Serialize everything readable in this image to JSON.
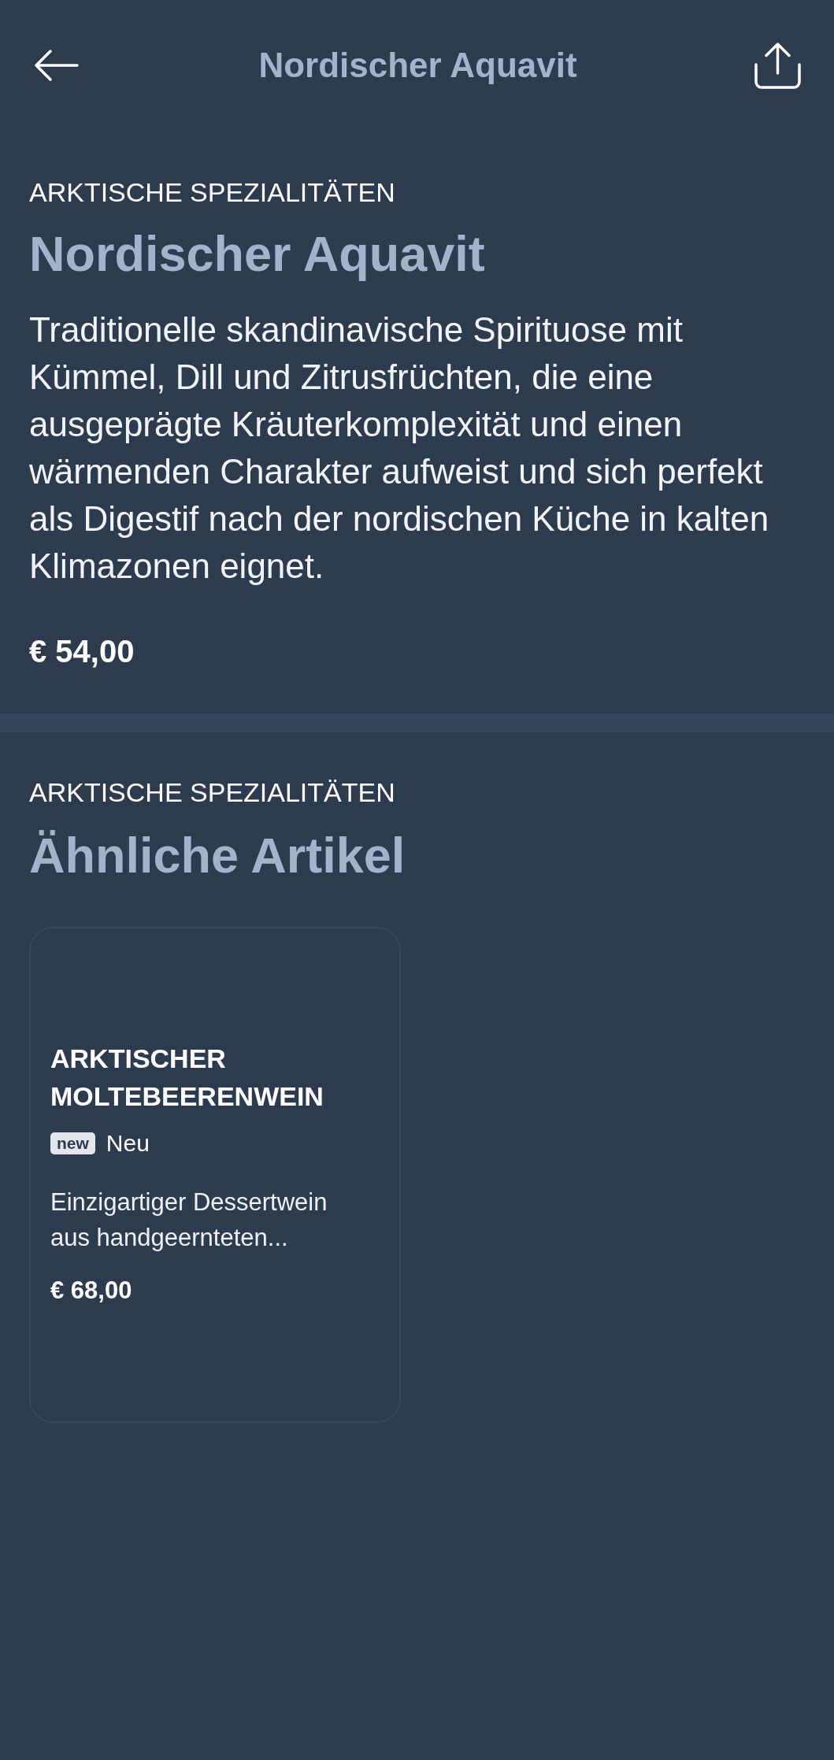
{
  "header": {
    "title": "Nordischer Aquavit"
  },
  "product": {
    "category": "ARKTISCHE SPEZIALITÄTEN",
    "name": "Nordischer Aquavit",
    "description": "Traditionelle skandinavische Spirituose mit Kümmel, Dill und Zitrusfrüchten, die eine ausgeprägte Kräuterkomplexität und einen wärmenden Charakter aufweist und sich perfekt als Digestif nach der nordischen Küche in kalten Klimazonen eignet.",
    "price": "€ 54,00"
  },
  "related": {
    "category": "ARKTISCHE SPEZIALITÄTEN",
    "heading": "Ähnliche Artikel",
    "items": [
      {
        "name": "ARKTISCHER MOLTEBEERENWEIN",
        "badge": "new",
        "status": "Neu",
        "description": "Einzigartiger Dessertwein aus handgeernteten...",
        "price": "€ 68,00"
      }
    ]
  }
}
